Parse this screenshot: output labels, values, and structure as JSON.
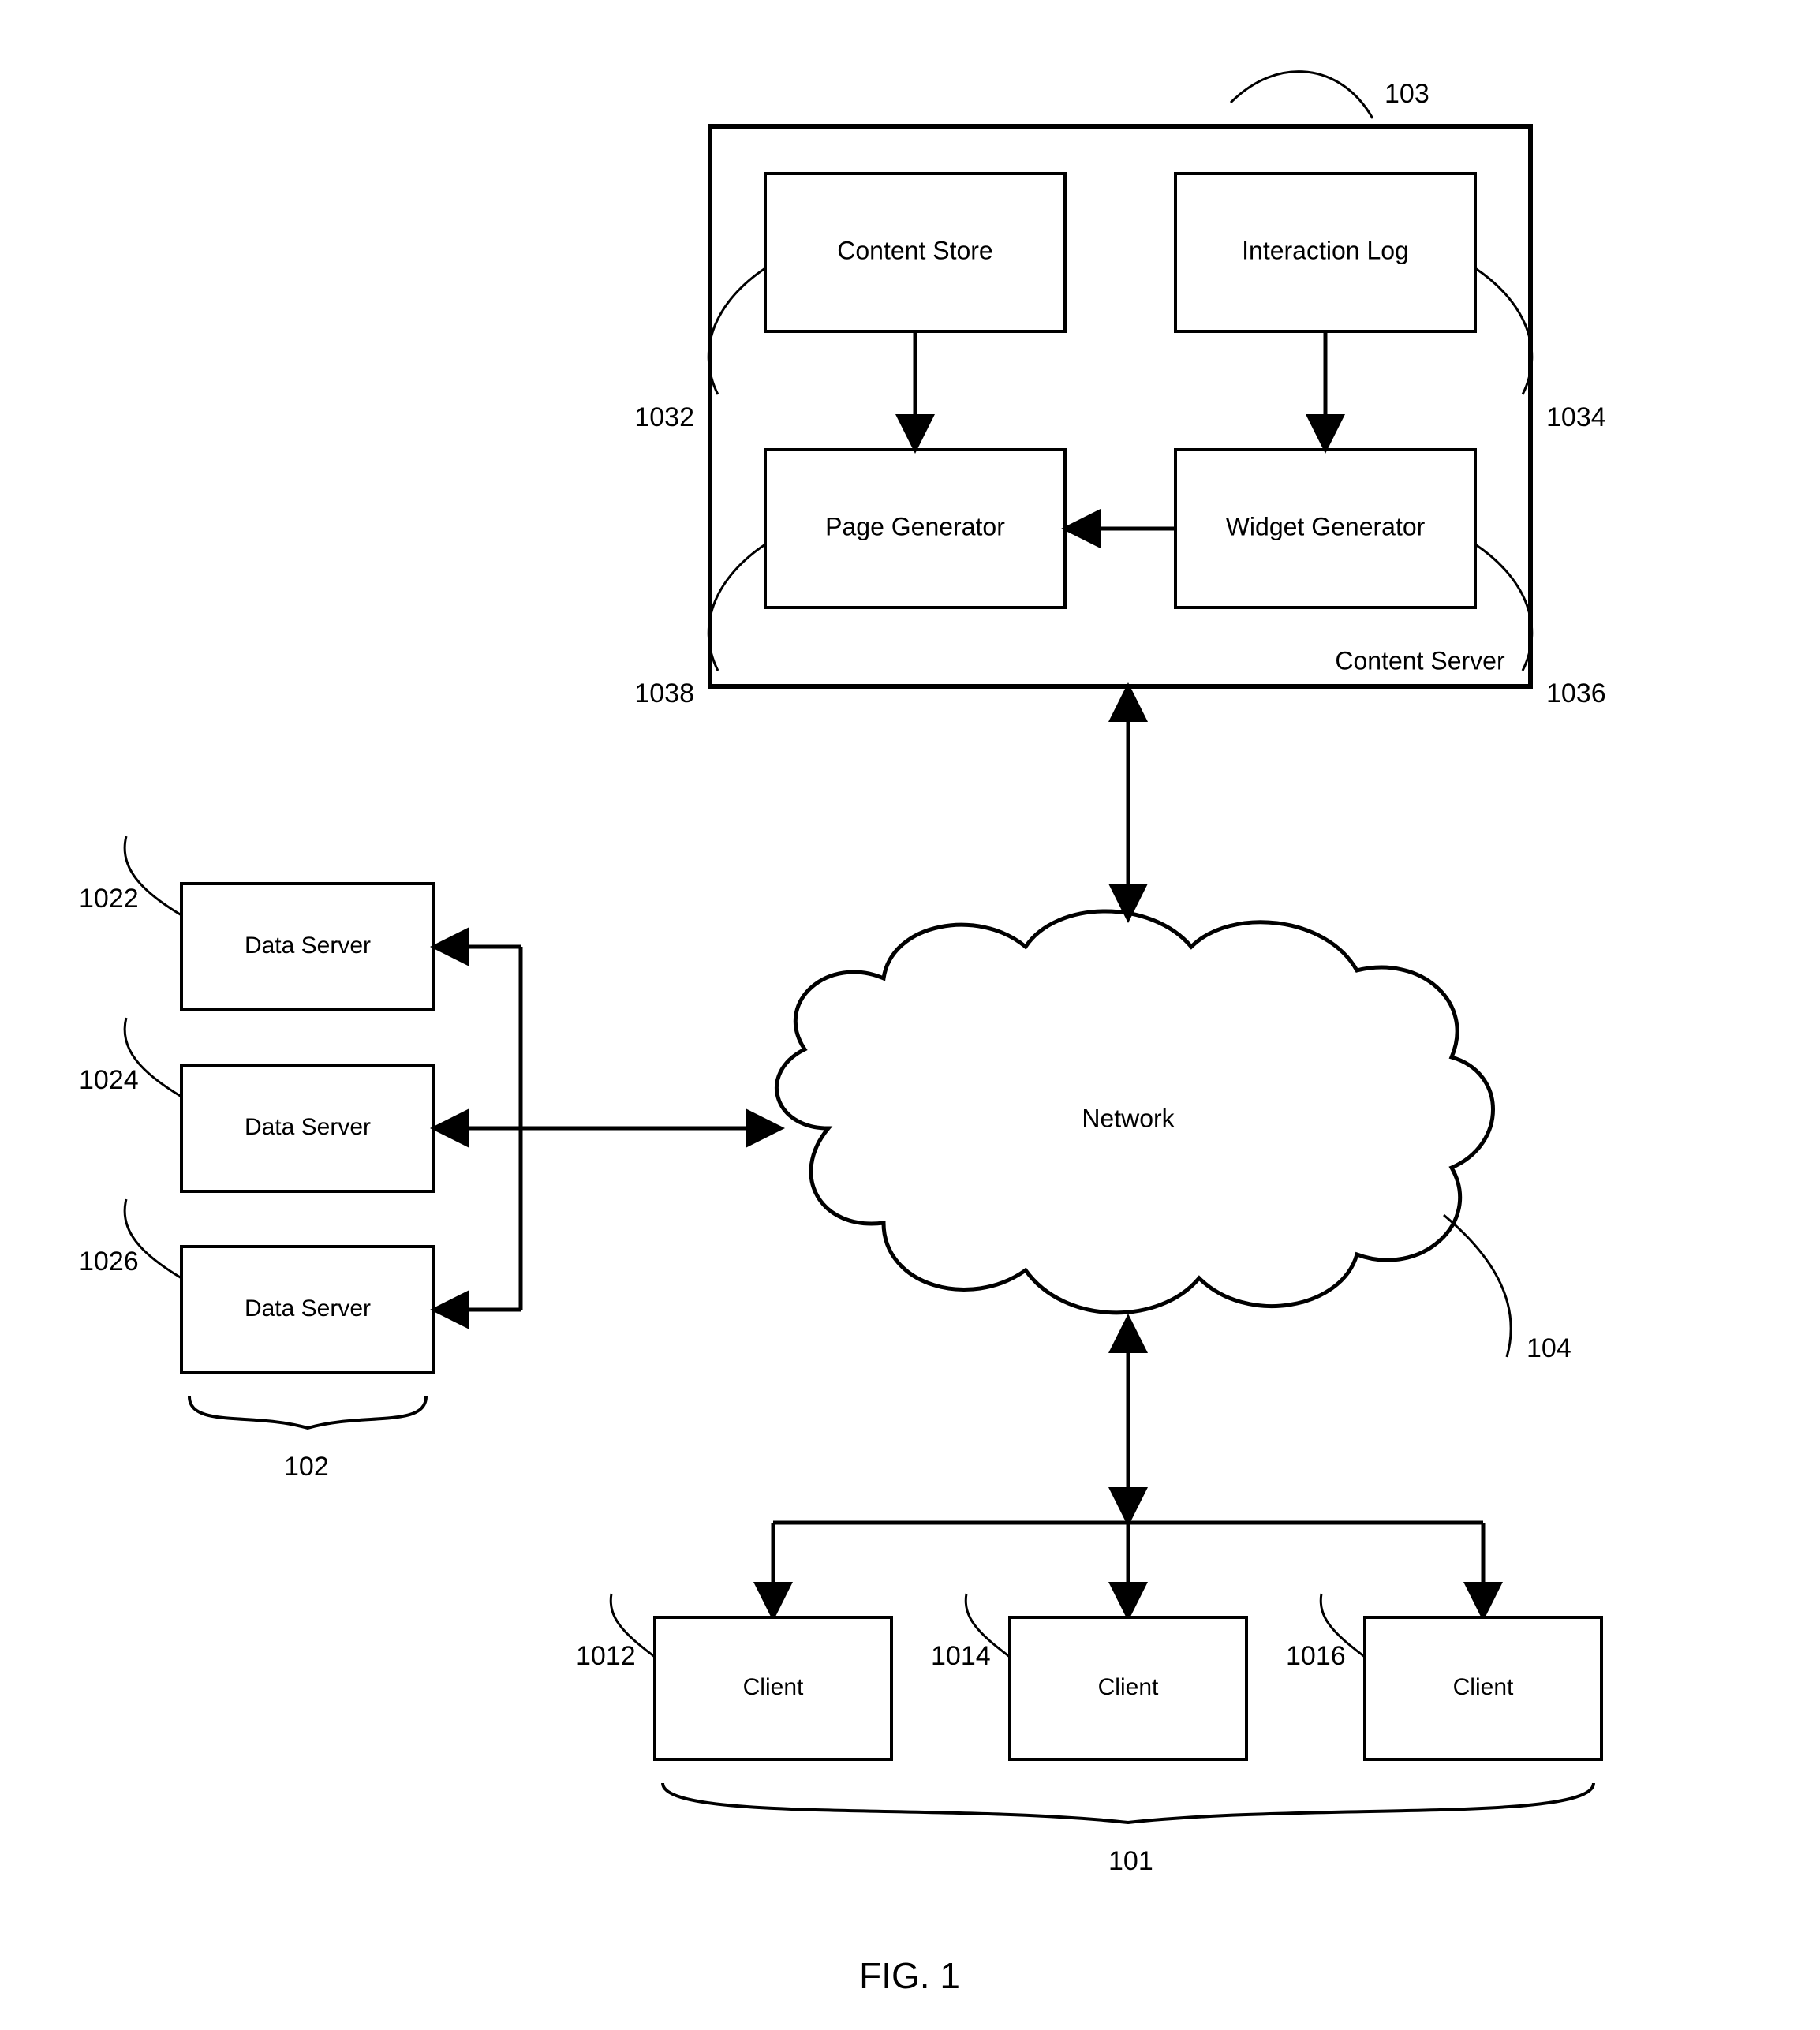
{
  "figureLabel": "FIG. 1",
  "contentServer": {
    "containerLabel": "Content Server",
    "ref": "103",
    "contentStore": {
      "label": "Content Store",
      "ref": "1032"
    },
    "interactionLog": {
      "label": "Interaction Log",
      "ref": "1034"
    },
    "pageGenerator": {
      "label": "Page Generator",
      "ref": "1038"
    },
    "widgetGenerator": {
      "label": "Widget Generator",
      "ref": "1036"
    }
  },
  "network": {
    "label": "Network",
    "ref": "104"
  },
  "dataServers": {
    "groupRef": "102",
    "items": [
      {
        "label": "Data Server",
        "ref": "1022"
      },
      {
        "label": "Data Server",
        "ref": "1024"
      },
      {
        "label": "Data Server",
        "ref": "1026"
      }
    ]
  },
  "clients": {
    "groupRef": "101",
    "items": [
      {
        "label": "Client",
        "ref": "1012"
      },
      {
        "label": "Client",
        "ref": "1014"
      },
      {
        "label": "Client",
        "ref": "1016"
      }
    ]
  }
}
